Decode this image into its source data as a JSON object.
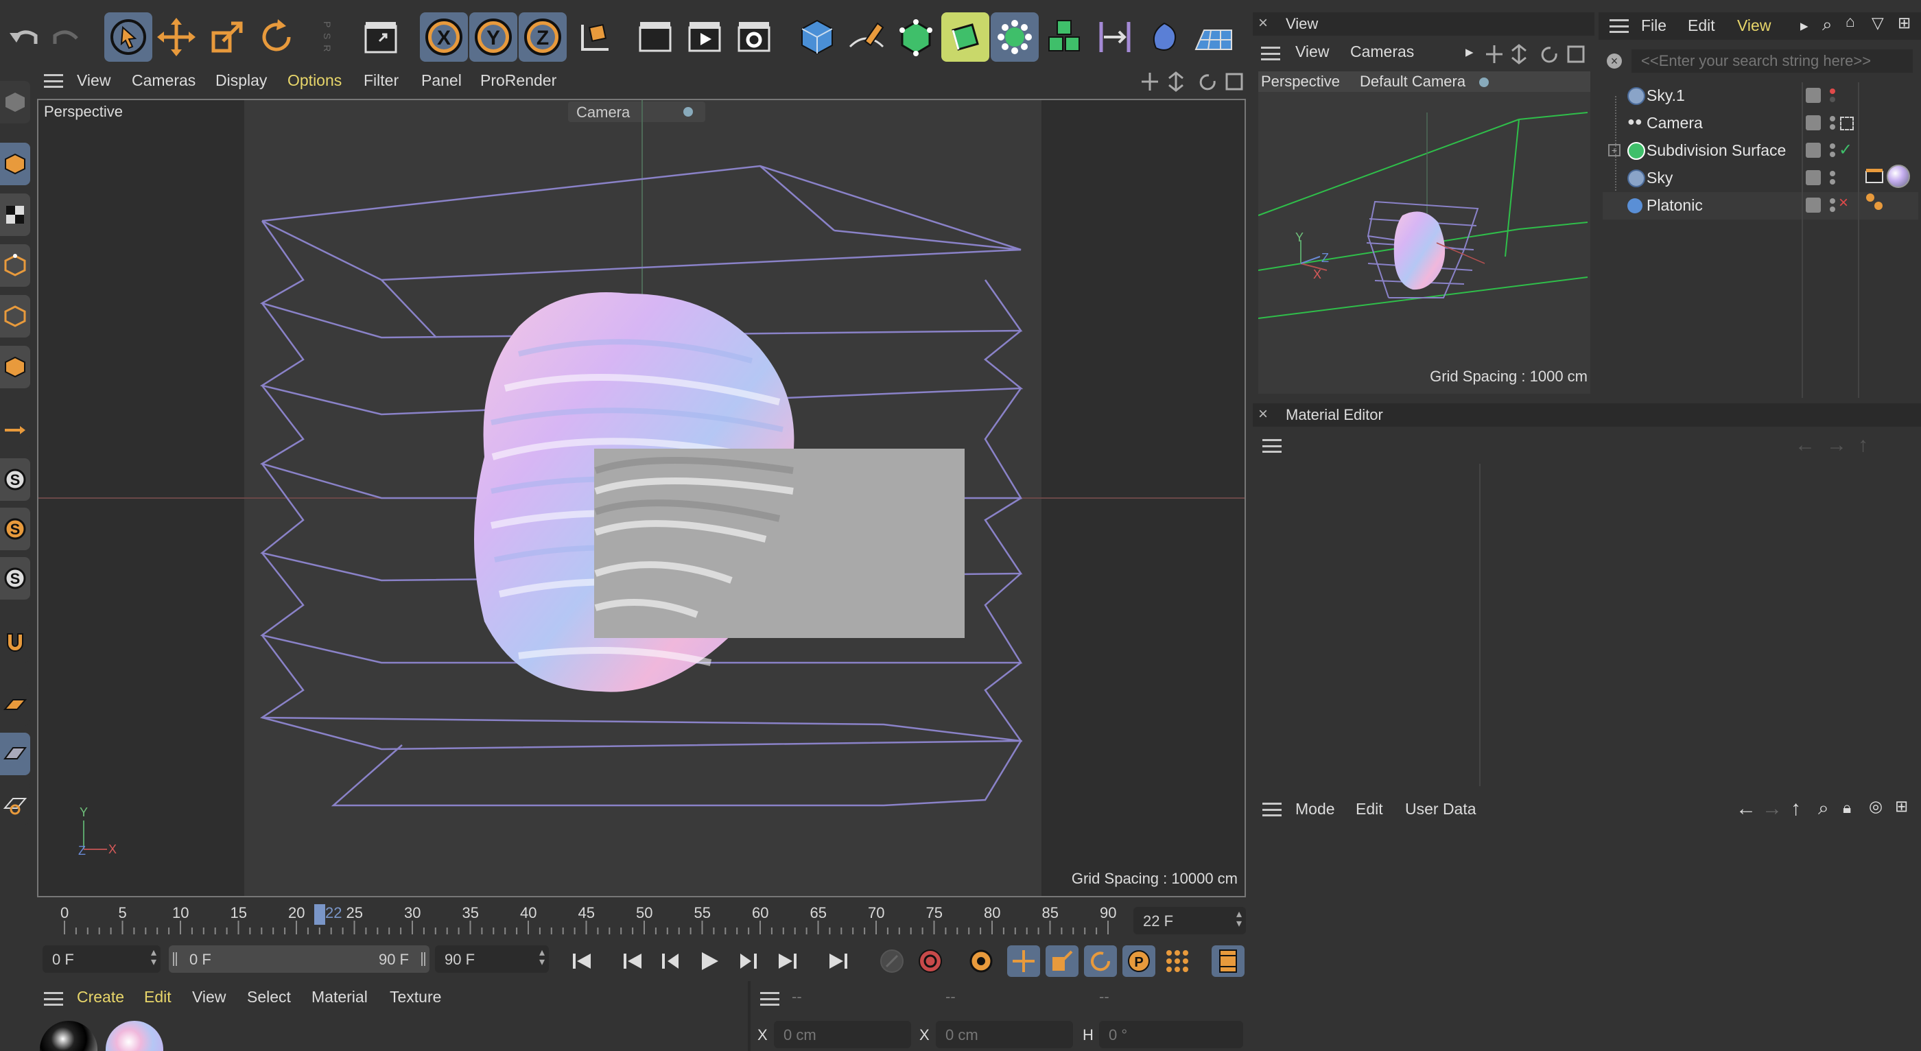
{
  "toolbar": {
    "icons": [
      "undo-icon",
      "redo-icon",
      "select-arrow-icon",
      "move-icon",
      "scale-icon",
      "rotate-icon",
      "psr-icon",
      "clapper-icon",
      "x-axis-lock-icon",
      "y-axis-lock-icon",
      "z-axis-lock-icon",
      "coordinate-system-icon",
      "render-region-icon",
      "render-view-icon",
      "render-settings-icon",
      "cube-icon",
      "pen-icon",
      "subdivision-icon",
      "extrude-icon",
      "mograph-icon",
      "cloner-icon",
      "deformer-icon",
      "generator-icon",
      "floor-icon"
    ],
    "axis_labels": [
      "X",
      "Y",
      "Z"
    ],
    "psr_label": "P S R"
  },
  "viewport": {
    "menu": [
      "View",
      "Cameras",
      "Display",
      "Options",
      "Filter",
      "Panel",
      "ProRender"
    ],
    "active_menu": "Options",
    "projection": "Perspective",
    "camera": "Camera",
    "grid_spacing": "Grid Spacing : 10000 cm",
    "axis": {
      "y": "Y",
      "z": "Z",
      "x": "X"
    }
  },
  "view_panel": {
    "title": "View",
    "menu": [
      "View",
      "Cameras"
    ],
    "projection": "Perspective",
    "camera": "Default Camera",
    "grid_spacing": "Grid Spacing : 1000 cm",
    "axis": {
      "y": "Y",
      "z": "Z",
      "x": "X"
    }
  },
  "object_manager": {
    "menu": [
      "File",
      "Edit",
      "View"
    ],
    "active_menu": "View",
    "search_placeholder": "<<Enter your search string here>>",
    "objects": [
      {
        "name": "Sky.1",
        "icon": "sky-icon"
      },
      {
        "name": "Camera",
        "icon": "camera-icon"
      },
      {
        "name": "Subdivision Surface",
        "icon": "subdivision-surface-icon"
      },
      {
        "name": "Sky",
        "icon": "sky-icon"
      },
      {
        "name": "Platonic",
        "icon": "platonic-icon"
      }
    ]
  },
  "material_editor": {
    "title": "Material Editor"
  },
  "attributes": {
    "menu": [
      "Mode",
      "Edit",
      "User Data"
    ]
  },
  "timeline": {
    "ticks": [
      "0",
      "5",
      "10",
      "15",
      "20",
      "25",
      "30",
      "35",
      "40",
      "45",
      "50",
      "55",
      "60",
      "65",
      "70",
      "75",
      "80",
      "85",
      "90"
    ],
    "current_frame_marker": "22",
    "current_frame": "22 F",
    "start_field": "0 F",
    "range_start": "0 F",
    "range_end": "90 F",
    "end_field": "90 F"
  },
  "material_manager": {
    "menu": [
      "Create",
      "Edit",
      "View",
      "Select",
      "Material",
      "Texture"
    ],
    "active_menu": "Create"
  },
  "coordinates": {
    "headers": [
      "--",
      "--",
      "--"
    ],
    "x_label": "X",
    "x_value": "0 cm",
    "x2_label": "X",
    "x2_value": "0 cm",
    "h_label": "H",
    "h_value": "0 °"
  },
  "colors": {
    "accent": "#e89a3c",
    "selection": "#5a6f8c",
    "active_menu": "#e8d66a"
  }
}
